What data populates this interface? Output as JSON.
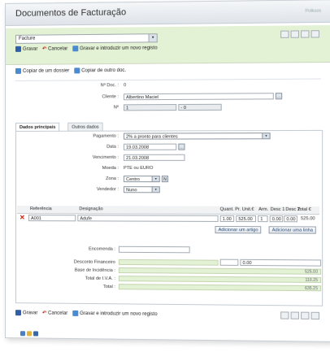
{
  "window": {
    "title": "Documentos de Facturação",
    "title_right": "Polikaos"
  },
  "toolbar": {
    "doc_type": "Facture",
    "save_label": "Gravar",
    "cancel_label": "Cancelar",
    "save_new_label": "Gravar e introduzir um novo registo"
  },
  "copy": {
    "from_dossier": "Copiar de um dossier",
    "from_other": "Copiar de outro doc."
  },
  "header": {
    "num_doc_label": "Nº Doc. :",
    "num_doc_value": "0",
    "client_label": "Cliente :",
    "client_value": "Albertino Maciel",
    "no_label": "Nº",
    "no_value1": "1",
    "no_value2": "- 0"
  },
  "tabs": [
    {
      "label": "Dados principais"
    },
    {
      "label": "Outros dados"
    }
  ],
  "main": {
    "pagamento_label": "Pagamento :",
    "pagamento_value": "2% a pronto para clientes",
    "data_label": "Data :",
    "data_value": "19.03.2008",
    "vencimento_label": "Vencimento :",
    "vencimento_value": "21.03.2008",
    "moeda_label": "Moeda :",
    "moeda_value": "PTE ou EURO",
    "zona_label": "Zona :",
    "zona_value": "Centro",
    "zona_btn": "N",
    "vendedor_label": "Vendedor :",
    "vendedor_value": "Nuno"
  },
  "table": {
    "headers": [
      "Referência",
      "Designação",
      "Quant.",
      "Pr. Unit.€",
      "Arm.",
      "Desc 1",
      "Desc 2",
      "Total €"
    ],
    "rows": [
      {
        "ref": "A001",
        "designacao": "Adufe",
        "quant": "1.00",
        "pr_unit": "525.00",
        "arm": "1",
        "desc1": "0.00",
        "desc2": "0.00",
        "total": "525.00"
      }
    ],
    "add_item_label": "Adicionar um artigo",
    "add_line_label": "Adicionar uma linha"
  },
  "totals": {
    "encomenda_label": "Encomenda :",
    "desconto_label": "Desconto Financeiro",
    "desconto_value": "0.00",
    "base_label": "Base de Incidência :",
    "base_value": "525.00",
    "iva_label": "Total de I.V.A. :",
    "iva_value": "110.25",
    "total_label": "Total :",
    "total_value": "635.25"
  }
}
